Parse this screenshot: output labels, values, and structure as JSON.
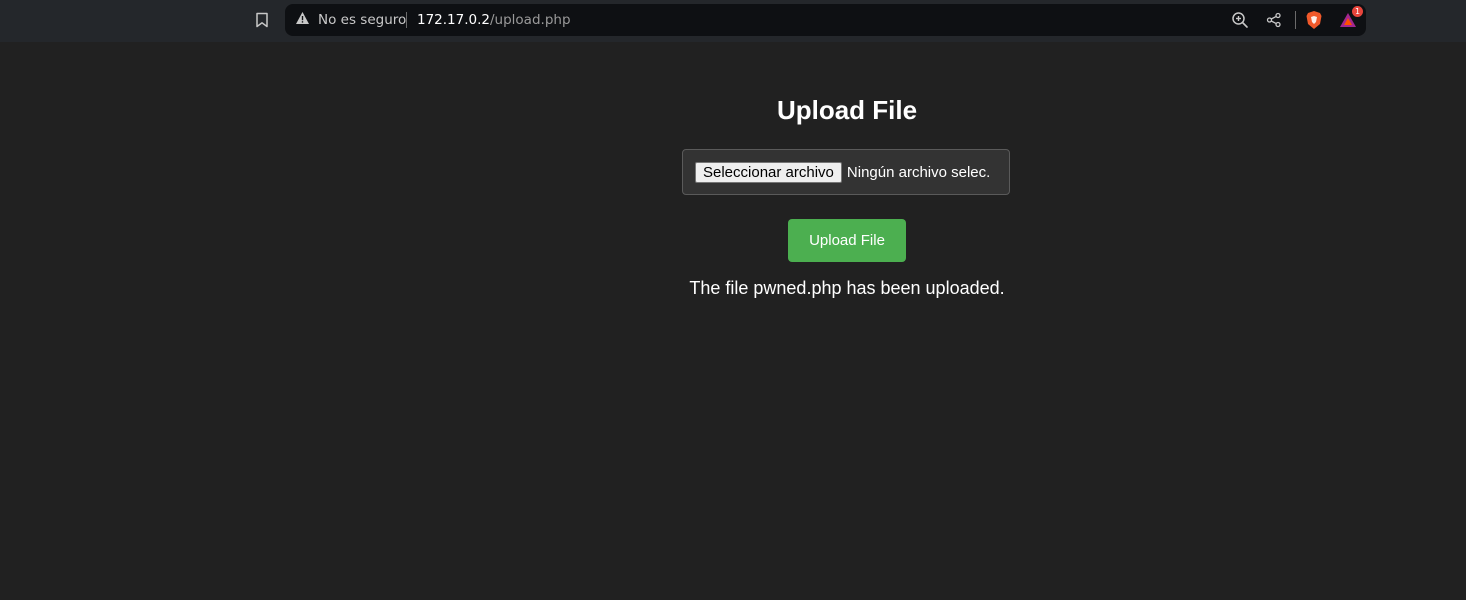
{
  "browser": {
    "security_label": "No es seguro",
    "url_host": "172.17.0.2",
    "url_path": "/upload.php",
    "notification_count": "1",
    "icons": {
      "bookmark": "bookmark-icon",
      "warning": "warning-icon",
      "zoom": "zoom-icon",
      "share": "share-icon",
      "brave": "brave-shield-icon",
      "rewards": "brave-rewards-icon"
    }
  },
  "page": {
    "title": "Upload File",
    "file_input": {
      "button_label": "Seleccionar archivo",
      "status_text": "Ningún archivo selec."
    },
    "submit_label": "Upload File",
    "message": "The file pwned.php has been uploaded."
  },
  "colors": {
    "background": "#212121",
    "accent_button": "#4caf50",
    "toolbar": "#24272b",
    "omnibox": "#0e1013"
  }
}
